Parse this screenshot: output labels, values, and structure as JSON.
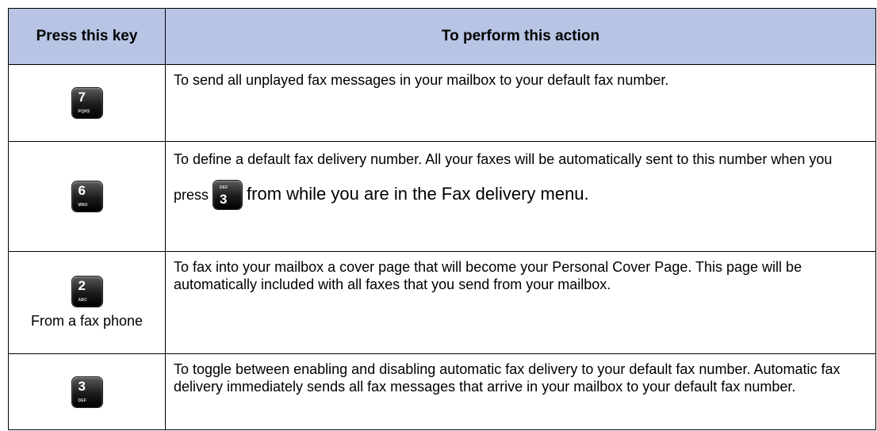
{
  "header": {
    "col1": "Press this key",
    "col2": "To perform this action"
  },
  "rows": [
    {
      "key": {
        "number": "7",
        "letters": "PQRS"
      },
      "text": "To send all unplayed fax messages in your mailbox to your default fax number."
    },
    {
      "key": {
        "number": "6",
        "letters": "MNO"
      },
      "text_before": "To define a default fax delivery number. All your faxes will be automatically sent to this number when you press",
      "inline_key": {
        "number": "3",
        "letters": "DEF"
      },
      "text_after": "from while you are in the Fax delivery menu."
    },
    {
      "key": {
        "number": "2",
        "letters": "ABC"
      },
      "key_note": "From a fax phone",
      "text": "To fax into your mailbox a cover page that will become your Personal Cover Page. This page will be automatically included with all faxes that you send from your mailbox."
    },
    {
      "key": {
        "number": "3",
        "letters": "DEF"
      },
      "text": "To toggle between enabling and disabling automatic fax delivery to your default fax number. Automatic fax delivery immediately sends all fax messages that arrive in your mailbox to your default fax number."
    }
  ],
  "colors": {
    "header_bg": "#b8c4e4",
    "key_bg": "#1b1b1b"
  }
}
